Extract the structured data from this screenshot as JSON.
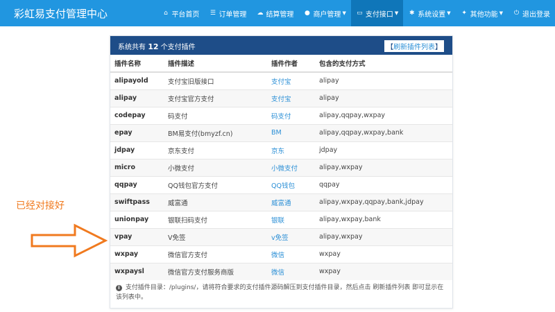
{
  "app": {
    "title": "彩虹易支付管理中心"
  },
  "nav": [
    {
      "label": "平台首页",
      "icon": "home-icon",
      "glyph": "⌂",
      "active": false,
      "dropdown": false
    },
    {
      "label": "订单管理",
      "icon": "list-icon",
      "glyph": "☰",
      "active": false,
      "dropdown": false
    },
    {
      "label": "结算管理",
      "icon": "cloud-icon",
      "glyph": "☁",
      "active": false,
      "dropdown": false
    },
    {
      "label": "商户管理",
      "icon": "user-icon",
      "glyph": "●",
      "active": false,
      "dropdown": true
    },
    {
      "label": "支付接口",
      "icon": "credit-card-icon",
      "glyph": "▭",
      "active": true,
      "dropdown": true
    },
    {
      "label": "系统设置",
      "icon": "gear-icon",
      "glyph": "✱",
      "active": false,
      "dropdown": true
    },
    {
      "label": "其他功能",
      "icon": "cubes-icon",
      "glyph": "✦",
      "active": false,
      "dropdown": true
    },
    {
      "label": "退出登录",
      "icon": "power-icon",
      "glyph": "⏻",
      "active": false,
      "dropdown": false
    }
  ],
  "panel": {
    "title_prefix": "系统共有",
    "count": "12",
    "title_suffix": "个支付插件",
    "refresh_open": "【",
    "refresh_label": "刷新插件列表",
    "refresh_close": "】"
  },
  "table": {
    "headers": [
      "插件名称",
      "插件描述",
      "插件作者",
      "包含的支付方式"
    ],
    "rows": [
      {
        "name": "alipayold",
        "desc": "支付宝旧版接口",
        "author": "支付宝",
        "methods": "alipay"
      },
      {
        "name": "alipay",
        "desc": "支付宝官方支付",
        "author": "支付宝",
        "methods": "alipay"
      },
      {
        "name": "codepay",
        "desc": "码支付",
        "author": "码支付",
        "methods": "alipay,qqpay,wxpay"
      },
      {
        "name": "epay",
        "desc": "BM易支付(bmyzf.cn)",
        "author": "BM",
        "methods": "alipay,qqpay,wxpay,bank"
      },
      {
        "name": "jdpay",
        "desc": "京东支付",
        "author": "京东",
        "methods": "jdpay"
      },
      {
        "name": "micro",
        "desc": "小微支付",
        "author": "小微支付",
        "methods": "alipay,wxpay"
      },
      {
        "name": "qqpay",
        "desc": "QQ钱包官方支付",
        "author": "QQ钱包",
        "methods": "qqpay"
      },
      {
        "name": "swiftpass",
        "desc": "威富通",
        "author": "威富通",
        "methods": "alipay,wxpay,qqpay,bank,jdpay"
      },
      {
        "name": "unionpay",
        "desc": "银联扫码支付",
        "author": "银联",
        "methods": "alipay,wxpay,bank"
      },
      {
        "name": "vpay",
        "desc": "V免签",
        "author": "v免签",
        "methods": "alipay,wxpay"
      },
      {
        "name": "wxpay",
        "desc": "微信官方支付",
        "author": "微信",
        "methods": "wxpay"
      },
      {
        "name": "wxpaysl",
        "desc": "微信官方支付服务商版",
        "author": "微信",
        "methods": "wxpay"
      }
    ]
  },
  "footnote": {
    "icon": "info-icon",
    "text": "支付插件目录：/plugins/，请将符合要求的支付插件源码解压到支付插件目录，然后点击 刷新插件列表 即可显示在该列表中。"
  },
  "annotation": {
    "text": "已经对接好",
    "color": "#f07a1f"
  }
}
